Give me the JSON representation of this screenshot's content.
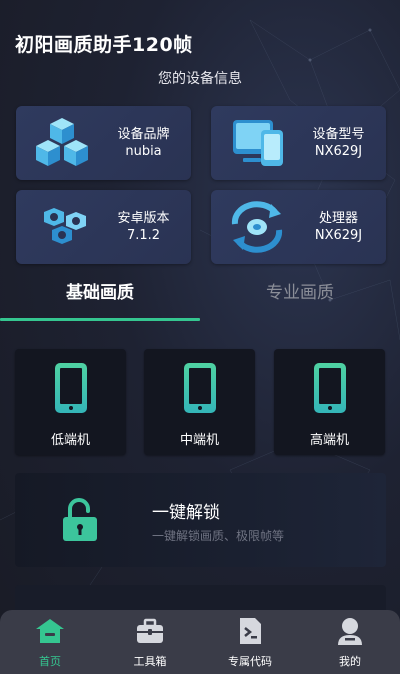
{
  "app": {
    "title": "初阳画质助手120帧"
  },
  "device_info": {
    "heading": "您的设备信息",
    "cards": [
      {
        "label": "设备品牌",
        "value": "nubia",
        "icon": "cubes-icon"
      },
      {
        "label": "设备型号",
        "value": "NX629J",
        "icon": "devices-icon"
      },
      {
        "label": "安卓版本",
        "value": "7.1.2",
        "icon": "nuts-icon"
      },
      {
        "label": "处理器",
        "value": "NX629J",
        "icon": "processor-refresh-icon"
      }
    ]
  },
  "tabs": {
    "basic": "基础画质",
    "pro": "专业画质",
    "active": "basic"
  },
  "device_tiers": [
    {
      "label": "低端机",
      "icon": "phone-icon"
    },
    {
      "label": "中端机",
      "icon": "phone-icon"
    },
    {
      "label": "高端机",
      "icon": "phone-icon"
    }
  ],
  "unlock": {
    "title": "一键解锁",
    "desc": "一键解锁画质、极限帧等",
    "icon": "unlock-icon"
  },
  "nav": [
    {
      "label": "首页",
      "icon": "home-icon",
      "active": true
    },
    {
      "label": "工具箱",
      "icon": "toolbox-icon",
      "active": false
    },
    {
      "label": "专属代码",
      "icon": "code-file-icon",
      "active": false
    },
    {
      "label": "我的",
      "icon": "user-icon",
      "active": false
    }
  ],
  "colors": {
    "accent": "#35c690",
    "card_bg": "#2f3a5e",
    "nav_bg": "#3a3c48",
    "icon_blue": "#4fb8e8"
  }
}
